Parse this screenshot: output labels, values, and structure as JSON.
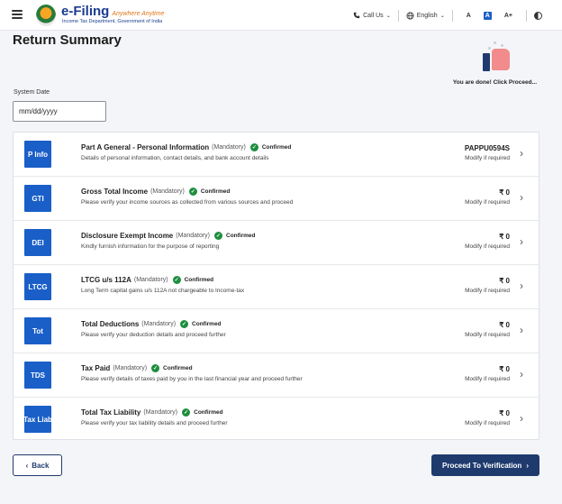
{
  "header": {
    "logo_title": "e-Filing",
    "logo_tagline": "Anywhere Anytime",
    "logo_subtitle": "Income Tax Department, Government of India",
    "call_us": "Call Us",
    "language": "English",
    "font_decrease": "A",
    "font_normal": "A",
    "font_increase": "A+"
  },
  "page": {
    "title": "Return Summary",
    "done_text": "You are done! Click Proceed...",
    "system_date_label": "System Date",
    "system_date_placeholder": "mm/dd/yyyy"
  },
  "rows": [
    {
      "badge": "P Info",
      "title": "Part A General - Personal Information",
      "mandatory": "(Mandatory)",
      "status": "Confirmed",
      "desc": "Details of personal information, contact details, and bank account details",
      "value": "PAPPU0594S",
      "modify": "Modify if required"
    },
    {
      "badge": "GTI",
      "title": "Gross Total Income",
      "mandatory": "(Mandatory)",
      "status": "Confirmed",
      "desc": "Please verify your income sources as collected from various sources and proceed",
      "value": "₹ 0",
      "modify": "Modify if required"
    },
    {
      "badge": "DEI",
      "title": "Disclosure Exempt Income",
      "mandatory": "(Mandatory)",
      "status": "Confirmed",
      "desc": "Kindly furnish information for the purpose of reporting",
      "value": "₹ 0",
      "modify": "Modify if required"
    },
    {
      "badge": "LTCG",
      "title": "LTCG u/s 112A",
      "mandatory": "(Mandatory)",
      "status": "Confirmed",
      "desc": "Long Term capital gains u/s 112A not chargeable to Income-tax",
      "value": "₹ 0",
      "modify": "Modify if required"
    },
    {
      "badge": "Tot",
      "title": "Total Deductions",
      "mandatory": "(Mandatory)",
      "status": "Confirmed",
      "desc": "Please verify your deduction details and proceed further",
      "value": "₹ 0",
      "modify": "Modify if required"
    },
    {
      "badge": "TDS",
      "title": "Tax Paid",
      "mandatory": "(Mandatory)",
      "status": "Confirmed",
      "desc": "Please verify details of taxes paid by you in the last financial year and proceed further",
      "value": "₹ 0",
      "modify": "Modify if required"
    },
    {
      "badge": "Tax Liab",
      "title": "Total Tax Liability",
      "mandatory": "(Mandatory)",
      "status": "Confirmed",
      "desc": "Please verify your tax liability details and proceed further",
      "value": "₹ 0",
      "modify": "Modify if required"
    }
  ],
  "footer": {
    "back_label": "Back",
    "proceed_label": "Proceed To Verification"
  },
  "icons": {
    "menu": "hamburger-icon",
    "phone": "phone-icon",
    "globe": "globe-icon",
    "contrast": "contrast-icon",
    "check": "check-circle-icon",
    "chevron": "chevron-right-icon"
  },
  "colors": {
    "primary": "#1f3b6e",
    "badge": "#1a5fc8",
    "confirmed": "#1e8e3e"
  }
}
